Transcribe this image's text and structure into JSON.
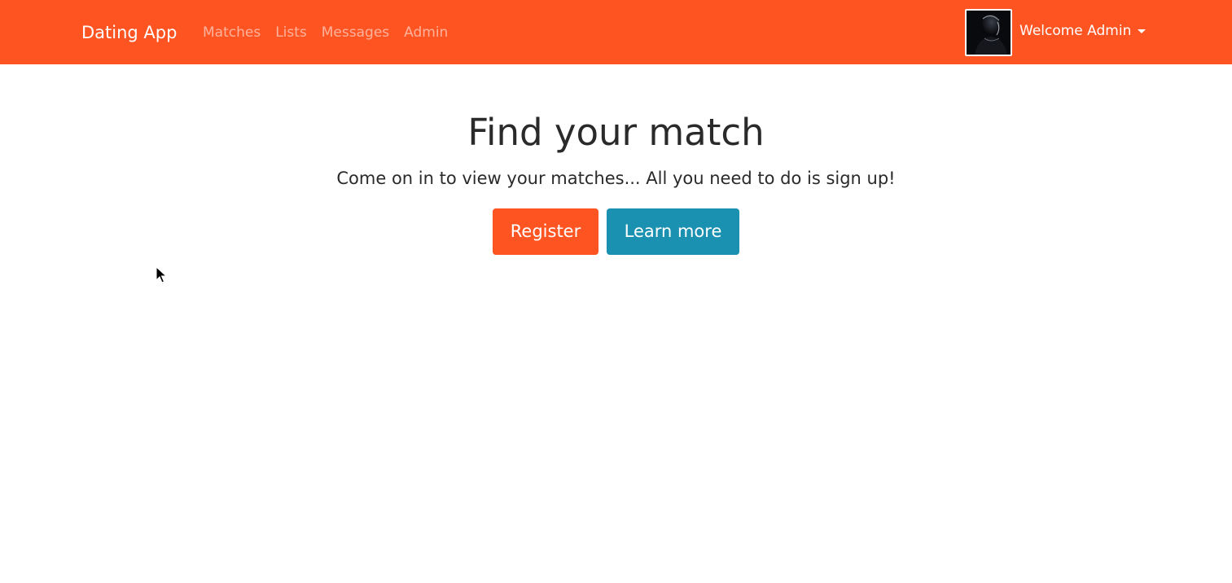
{
  "navbar": {
    "brand": "Dating App",
    "links": [
      "Matches",
      "Lists",
      "Messages",
      "Admin"
    ],
    "user_greeting": "Welcome Admin",
    "background_color": "#fe5422"
  },
  "hero": {
    "title": "Find your match",
    "lead": "Come on in to view your matches... All you need to do is sign up!",
    "register_label": "Register",
    "learn_more_label": "Learn more",
    "register_color": "#fe5422",
    "learn_more_color": "#1a91b0"
  },
  "icons": {
    "avatar": "user-photo",
    "dropdown": "caret-down-icon",
    "cursor": "mouse-pointer-icon"
  }
}
